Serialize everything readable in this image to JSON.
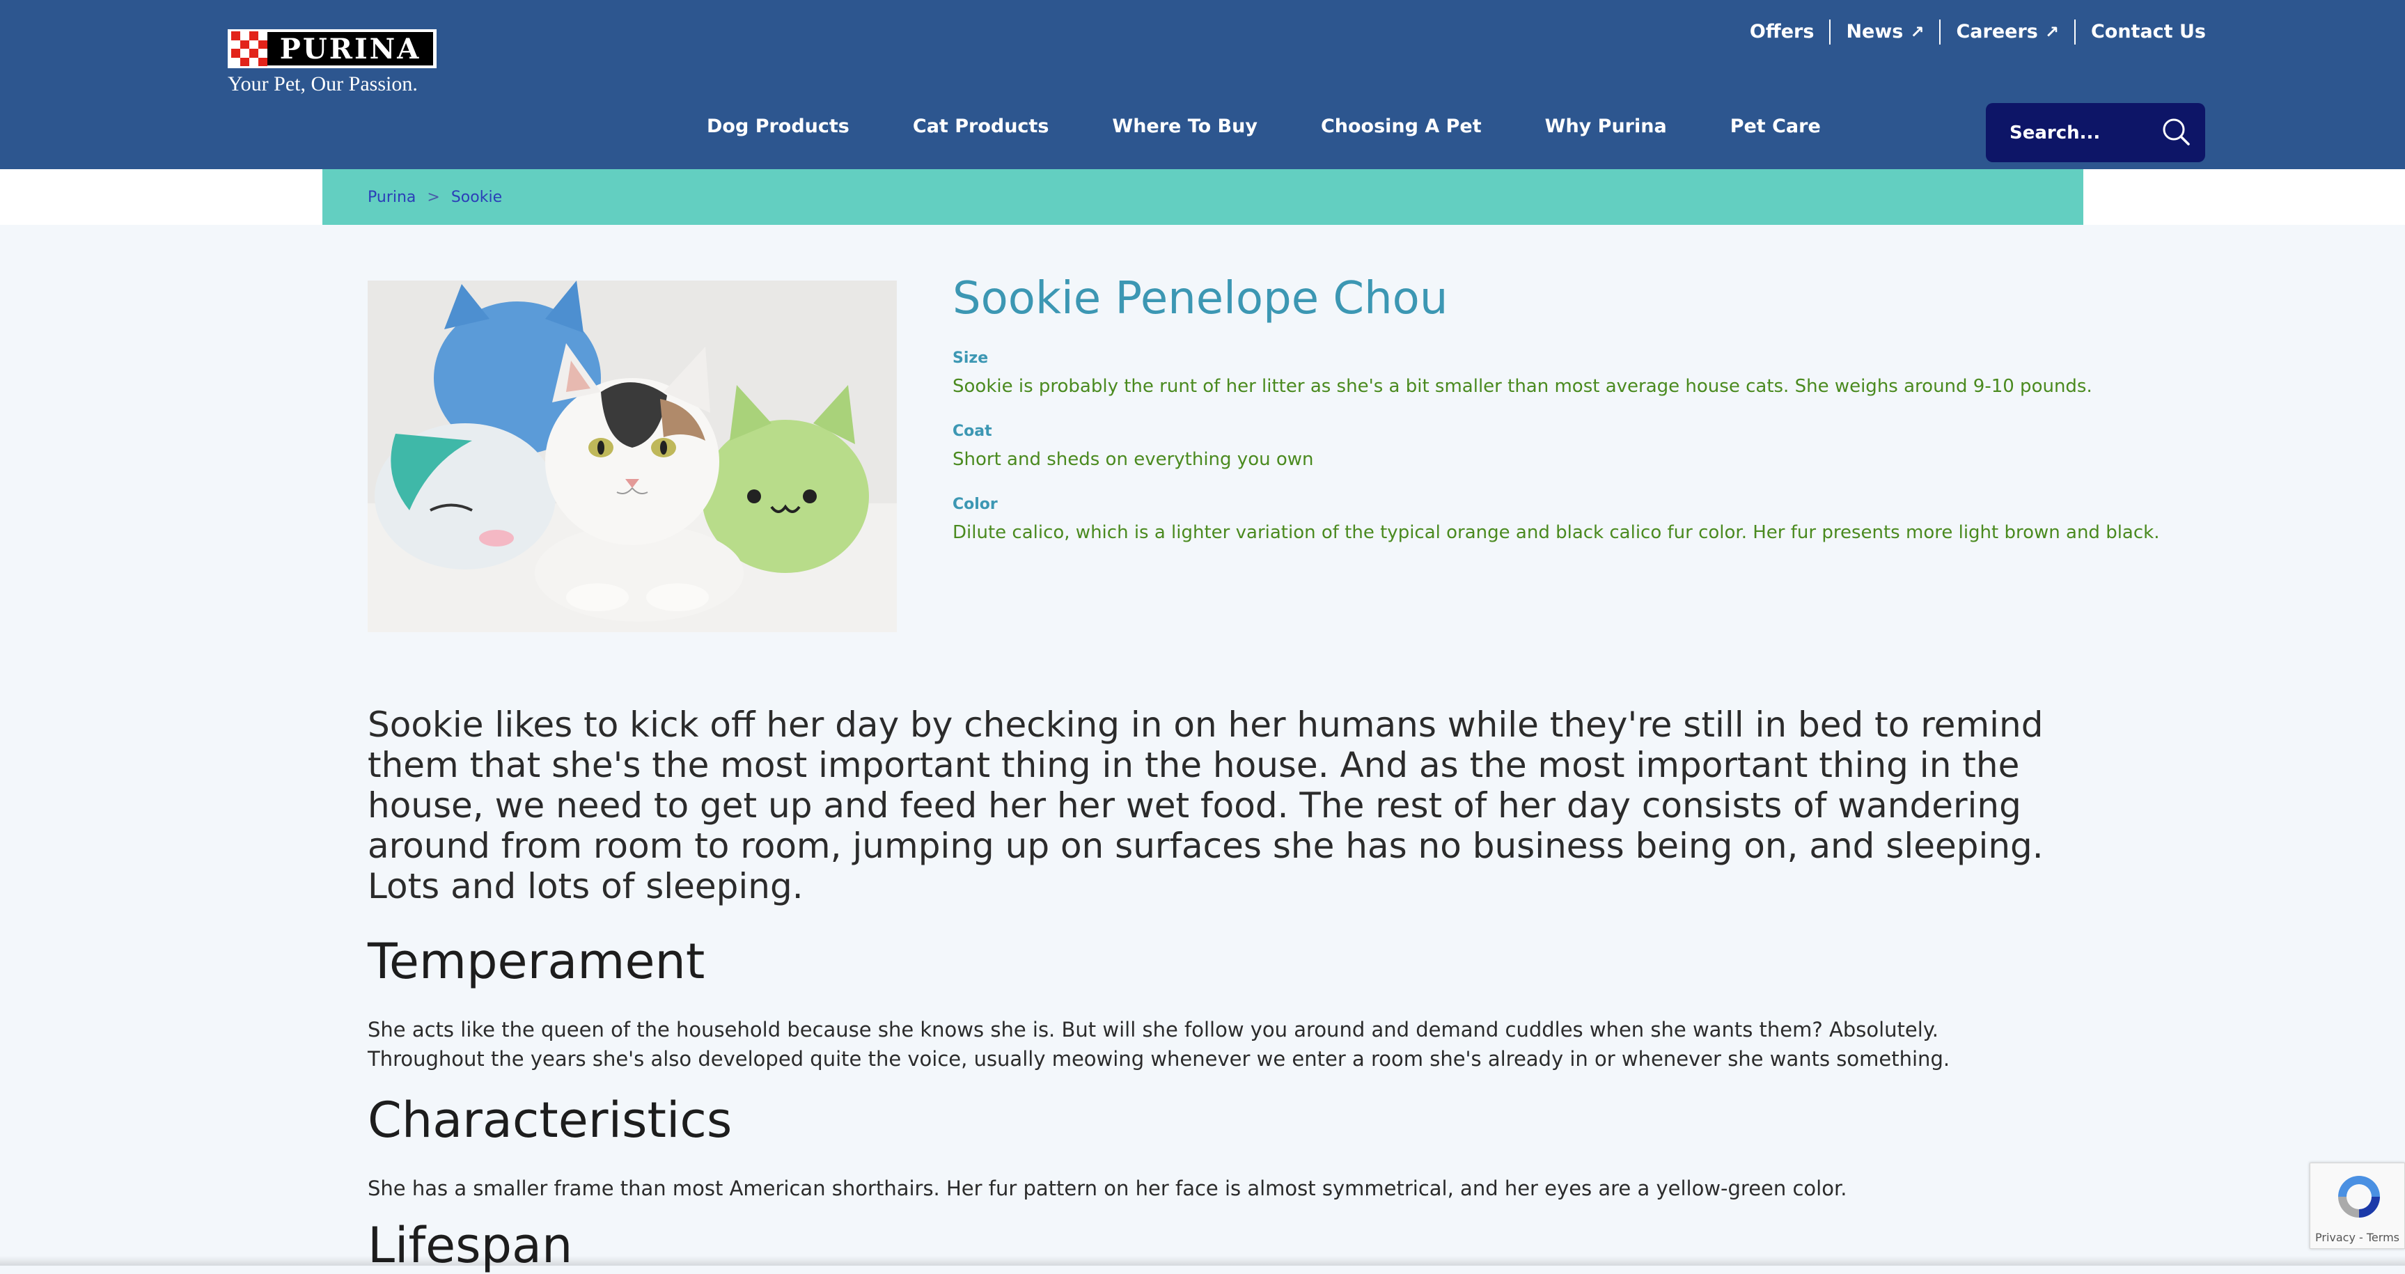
{
  "header": {
    "logo_text": "PURINA",
    "tagline": "Your Pet, Our Passion.",
    "utility_nav": [
      {
        "label": "Offers",
        "external": false
      },
      {
        "label": "News",
        "external": true
      },
      {
        "label": "Careers",
        "external": true
      },
      {
        "label": "Contact Us",
        "external": false
      }
    ],
    "main_nav": [
      "Dog Products",
      "Cat Products",
      "Where To Buy",
      "Choosing A Pet",
      "Why Purina",
      "Pet Care"
    ],
    "search": {
      "placeholder": "Search..."
    }
  },
  "breadcrumb": {
    "items": [
      "Purina",
      "Sookie"
    ],
    "separator": ">"
  },
  "profile": {
    "name": "Sookie Penelope Chou",
    "facts": [
      {
        "label": "Size",
        "value": "Sookie is probably the runt of her litter as she's a bit smaller than most average house cats. She weighs around 9-10 pounds."
      },
      {
        "label": "Coat",
        "value": "Short and sheds on everything you own"
      },
      {
        "label": "Color",
        "value": "Dilute calico, which is a lighter variation of the typical orange and black calico fur color. Her fur presents more light brown and black."
      }
    ]
  },
  "intro": "Sookie likes to kick off her day by checking in on her humans while they're still in bed to remind them that she's the most important thing in the house. And as the most important thing in the house, we need to get up and feed her her wet food. The rest of her day consists of wandering around from room to room, jumping up on surfaces she has no business being on, and sleeping. Lots and lots of sleeping.",
  "sections": [
    {
      "heading": "Temperament",
      "body": "She acts like the queen of the household because she knows she is. But will she follow you around and demand cuddles when she wants them? Absolutely. Throughout the years she's also developed quite the voice, usually meowing whenever we enter a room she's already in or whenever she wants something."
    },
    {
      "heading": "Characteristics",
      "body": "She has a smaller frame than most American shorthairs. Her fur pattern on her face is almost symmetrical, and her eyes are a yellow-green color."
    },
    {
      "heading": "Lifespan",
      "body": ""
    }
  ],
  "recaptcha": {
    "text": "Privacy - Terms"
  },
  "colors": {
    "header_bg": "#2d568f",
    "breadcrumb_bg": "#63cfc1",
    "search_bg": "#0d1567",
    "title": "#3c97b3",
    "fact_value": "#4a8a1f"
  }
}
